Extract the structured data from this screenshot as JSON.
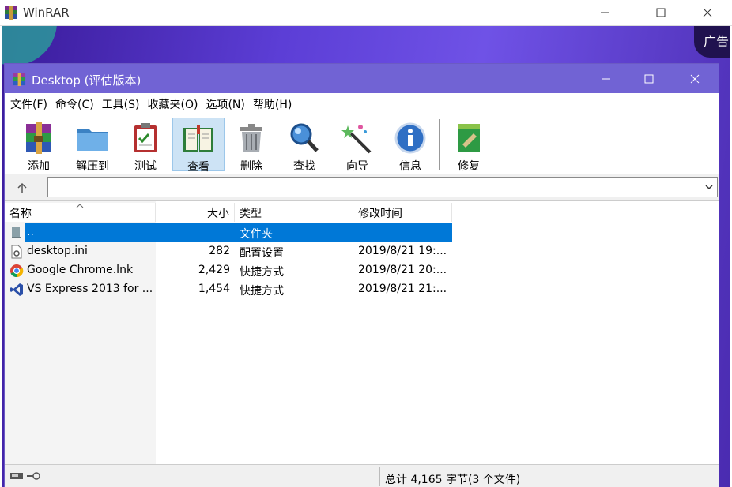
{
  "outer": {
    "title": "WinRAR",
    "ad_label": "广告"
  },
  "inner": {
    "title": "Desktop (评估版本)"
  },
  "menu": [
    "文件(F)",
    "命令(C)",
    "工具(S)",
    "收藏夹(O)",
    "选项(N)",
    "帮助(H)"
  ],
  "toolbar": [
    {
      "label": "添加",
      "icon": "add-archive-icon"
    },
    {
      "label": "解压到",
      "icon": "extract-folder-icon"
    },
    {
      "label": "测试",
      "icon": "test-clipboard-icon"
    },
    {
      "label": "查看",
      "icon": "view-book-icon",
      "active": true
    },
    {
      "label": "删除",
      "icon": "trash-icon"
    },
    {
      "label": "查找",
      "icon": "magnifier-icon"
    },
    {
      "label": "向导",
      "icon": "wizard-wand-icon"
    },
    {
      "label": "信息",
      "icon": "info-icon"
    },
    {
      "label": "修复",
      "icon": "repair-book-icon"
    }
  ],
  "address": {
    "value": ""
  },
  "columns": [
    "名称",
    "大小",
    "类型",
    "修改时间"
  ],
  "files": [
    {
      "name": "..",
      "size": "",
      "type": "文件夹",
      "modified": "",
      "icon": "parent-folder-icon",
      "selected": true
    },
    {
      "name": "desktop.ini",
      "size": "282",
      "type": "配置设置",
      "modified": "2019/8/21 19:...",
      "icon": "settings-file-icon"
    },
    {
      "name": "Google Chrome.lnk",
      "size": "2,429",
      "type": "快捷方式",
      "modified": "2019/8/21 20:...",
      "icon": "chrome-icon"
    },
    {
      "name": "VS Express 2013 for ...",
      "size": "1,454",
      "type": "快捷方式",
      "modified": "2019/8/21 21:...",
      "icon": "visual-studio-icon"
    }
  ],
  "status": {
    "summary": "总计 4,165 字节(3 个文件)"
  }
}
